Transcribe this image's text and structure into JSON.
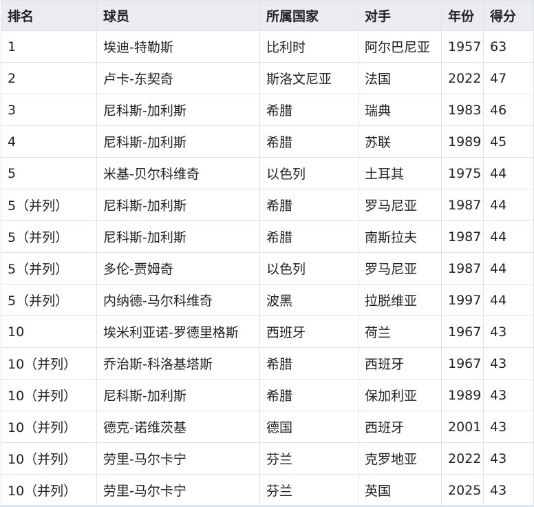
{
  "table": {
    "headers": [
      "排名",
      "球员",
      "所属国家",
      "对手",
      "年份",
      "得分"
    ],
    "rows": [
      [
        "1",
        "埃迪-特勒斯",
        "比利时",
        "阿尔巴尼亚",
        "1957",
        "63"
      ],
      [
        "2",
        "卢卡-东契奇",
        "斯洛文尼亚",
        "法国",
        "2022",
        "47"
      ],
      [
        "3",
        "尼科斯-加利斯",
        "希腊",
        "瑞典",
        "1983",
        "46"
      ],
      [
        "4",
        "尼科斯-加利斯",
        "希腊",
        "苏联",
        "1989",
        "45"
      ],
      [
        "5",
        "米基-贝尔科维奇",
        "以色列",
        "土耳其",
        "1975",
        "44"
      ],
      [
        "5（并列）",
        "尼科斯-加利斯",
        "希腊",
        "罗马尼亚",
        "1987",
        "44"
      ],
      [
        "5（并列）",
        "尼科斯-加利斯",
        "希腊",
        "南斯拉夫",
        "1987",
        "44"
      ],
      [
        "5（并列）",
        "多伦-贾姆奇",
        "以色列",
        "罗马尼亚",
        "1987",
        "44"
      ],
      [
        "5（并列）",
        "内纳德-马尔科维奇",
        "波黑",
        "拉脱维亚",
        "1997",
        "44"
      ],
      [
        "10",
        "埃米利亚诺-罗德里格斯",
        "西班牙",
        "荷兰",
        "1967",
        "43"
      ],
      [
        "10（并列）",
        "乔治斯-科洛基塔斯",
        "希腊",
        "西班牙",
        "1967",
        "43"
      ],
      [
        "10（并列）",
        "尼科斯-加利斯",
        "希腊",
        "保加利亚",
        "1989",
        "43"
      ],
      [
        "10（并列）",
        "德克-诺维茨基",
        "德国",
        "西班牙",
        "2001",
        "43"
      ],
      [
        "10（并列）",
        "劳里-马尔卡宁",
        "芬兰",
        "克罗地亚",
        "2022",
        "43"
      ],
      [
        "10（并列）",
        "劳里-马尔卡宁",
        "芬兰",
        "英国",
        "2025",
        "43"
      ]
    ]
  }
}
